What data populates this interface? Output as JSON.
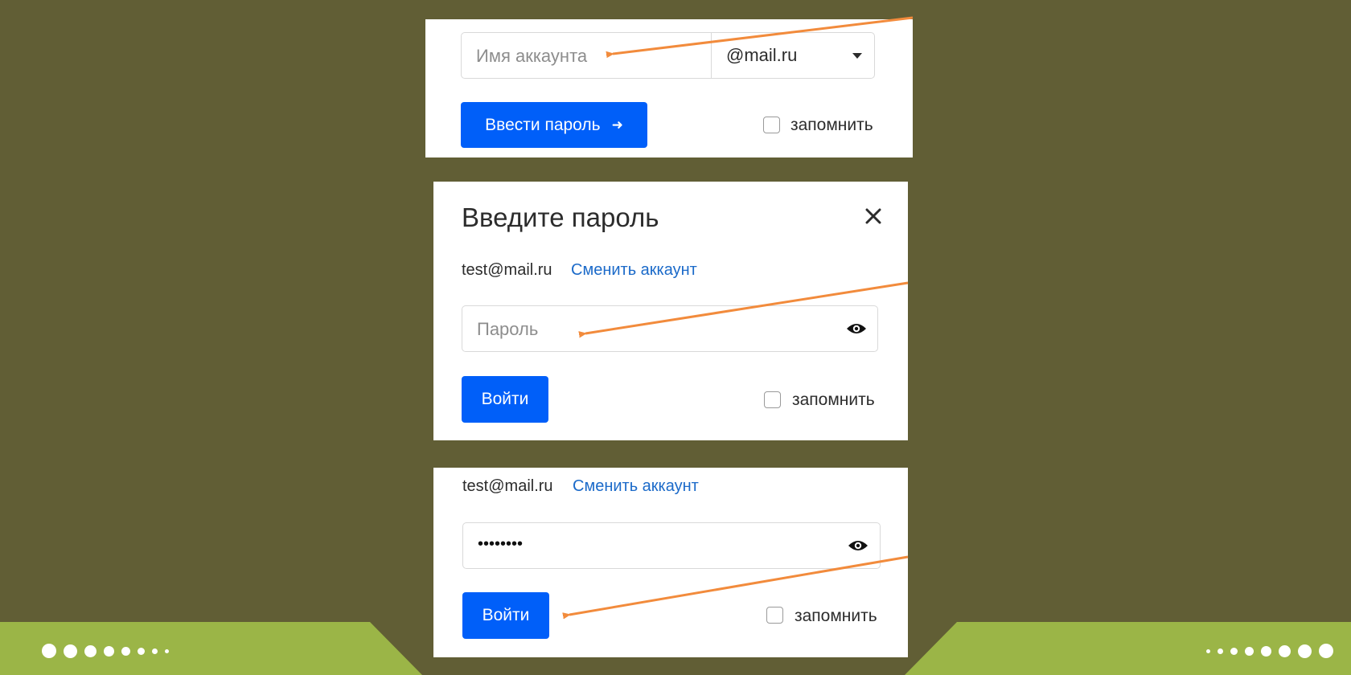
{
  "panel1": {
    "account_placeholder": "Имя аккаунта",
    "domain_value": "@mail.ru",
    "submit_label": "Ввести пароль",
    "submit_arrow": "➜",
    "remember_label": "запомнить"
  },
  "panel2": {
    "title": "Введите пароль",
    "close_glyph": "✕",
    "email": "test@mail.ru",
    "switch_link": "Сменить аккаунт",
    "password_placeholder": "Пароль",
    "login_label": "Войти",
    "remember_label": "запомнить"
  },
  "panel3": {
    "email": "test@mail.ru",
    "switch_link": "Сменить аккаунт",
    "password_value": "••••••••",
    "login_label": "Войти",
    "remember_label": "запомнить"
  },
  "colors": {
    "background": "#615e35",
    "footer": "#9bb547",
    "primary_button": "#005ff9",
    "link": "#1b6ac9",
    "annotation_arrow": "#f28b3c"
  },
  "icons": [
    "chevron-down-icon",
    "arrow-right-icon",
    "close-icon",
    "eye-icon"
  ]
}
